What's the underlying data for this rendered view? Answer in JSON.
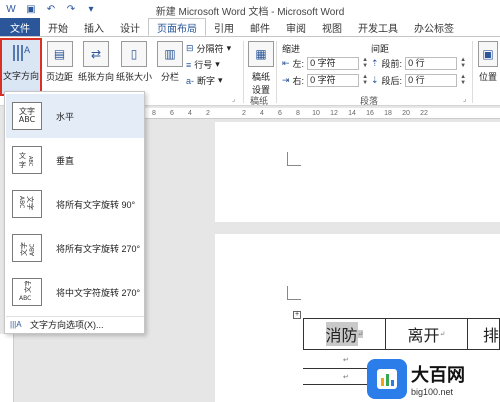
{
  "window": {
    "title": "新建 Microsoft Word 文档 - Microsoft Word"
  },
  "qat": {
    "icons": [
      "word-icon",
      "save-icon",
      "undo-icon",
      "redo-icon",
      "customize-icon"
    ]
  },
  "tabs": [
    {
      "label": "文件"
    },
    {
      "label": "开始"
    },
    {
      "label": "插入"
    },
    {
      "label": "设计"
    },
    {
      "label": "页面布局"
    },
    {
      "label": "引用"
    },
    {
      "label": "邮件"
    },
    {
      "label": "审阅"
    },
    {
      "label": "视图"
    },
    {
      "label": "开发工具"
    },
    {
      "label": "办公标签"
    }
  ],
  "ribbon": {
    "text_direction": "文字方向",
    "margins": "页边距",
    "orientation": "纸张方向",
    "size": "纸张大小",
    "columns": "分栏",
    "breaks": "分隔符",
    "line_numbers": "行号",
    "hyphenation": "断字",
    "manuscript": "稿纸\n设置",
    "manuscript_line1": "稿纸",
    "manuscript_line2": "设置",
    "manuscript_group": "稿纸",
    "indent_label": "缩进",
    "spacing_label": "间距",
    "indent_left_label": "左:",
    "indent_left_value": "0 字符",
    "indent_right_label": "右:",
    "indent_right_value": "0 字符",
    "spacing_before_label": "段前:",
    "spacing_before_value": "0 行",
    "spacing_after_label": "段后:",
    "spacing_after_value": "0 行",
    "paragraph_group": "段落",
    "position": "位置"
  },
  "ruler": {
    "ticks": [
      "8",
      "6",
      "4",
      "2",
      "",
      "2",
      "4",
      "6",
      "8",
      "10",
      "12",
      "14",
      "16",
      "18",
      "20",
      "22"
    ]
  },
  "dropdown": {
    "items": [
      {
        "icon_text": "文字\nABC",
        "label": "水平"
      },
      {
        "icon_text": "文字",
        "label": "垂直"
      },
      {
        "icon_text": "文字\nABC",
        "label": "将所有文字旋转 90°"
      },
      {
        "icon_text": "文字\nABC",
        "label": "将所有文字旋转 270°"
      },
      {
        "icon_text": "文字\nABC",
        "label": "将中文字符旋转 270°"
      }
    ],
    "footer": "文字方向选项(X)..."
  },
  "table": {
    "cells": [
      "消防",
      "离开",
      "排"
    ],
    "para_mark": "↵"
  },
  "watermark": {
    "title": "大百网",
    "url": "big100.net"
  },
  "colors": {
    "accent": "#2b579a",
    "highlight_border": "#d93025",
    "selected_bg": "#e4ecf7"
  }
}
